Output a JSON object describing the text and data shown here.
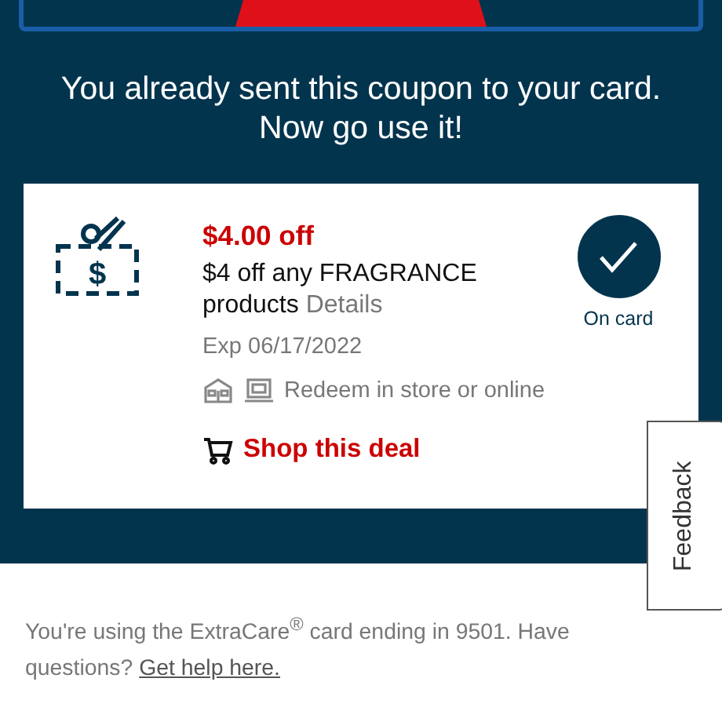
{
  "message": [
    "You already sent this coupon to your card.",
    "Now go use it!"
  ],
  "coupon": {
    "icon_symbol": "$",
    "amount": "$4.00 off",
    "description": "$4 off any FRAGRANCE products",
    "details_link": "Details",
    "expiry": "Exp 06/17/2022",
    "redeem": "Redeem in store or online",
    "shop_link": "Shop this deal",
    "on_card": true,
    "status": "On card"
  },
  "feedback_tab": "Feedback",
  "footer": {
    "text": "You're using the ExtraCare$^{®}$ card ending in 9501. Have questions?",
    "help_link": "Get help here."
  }
}
